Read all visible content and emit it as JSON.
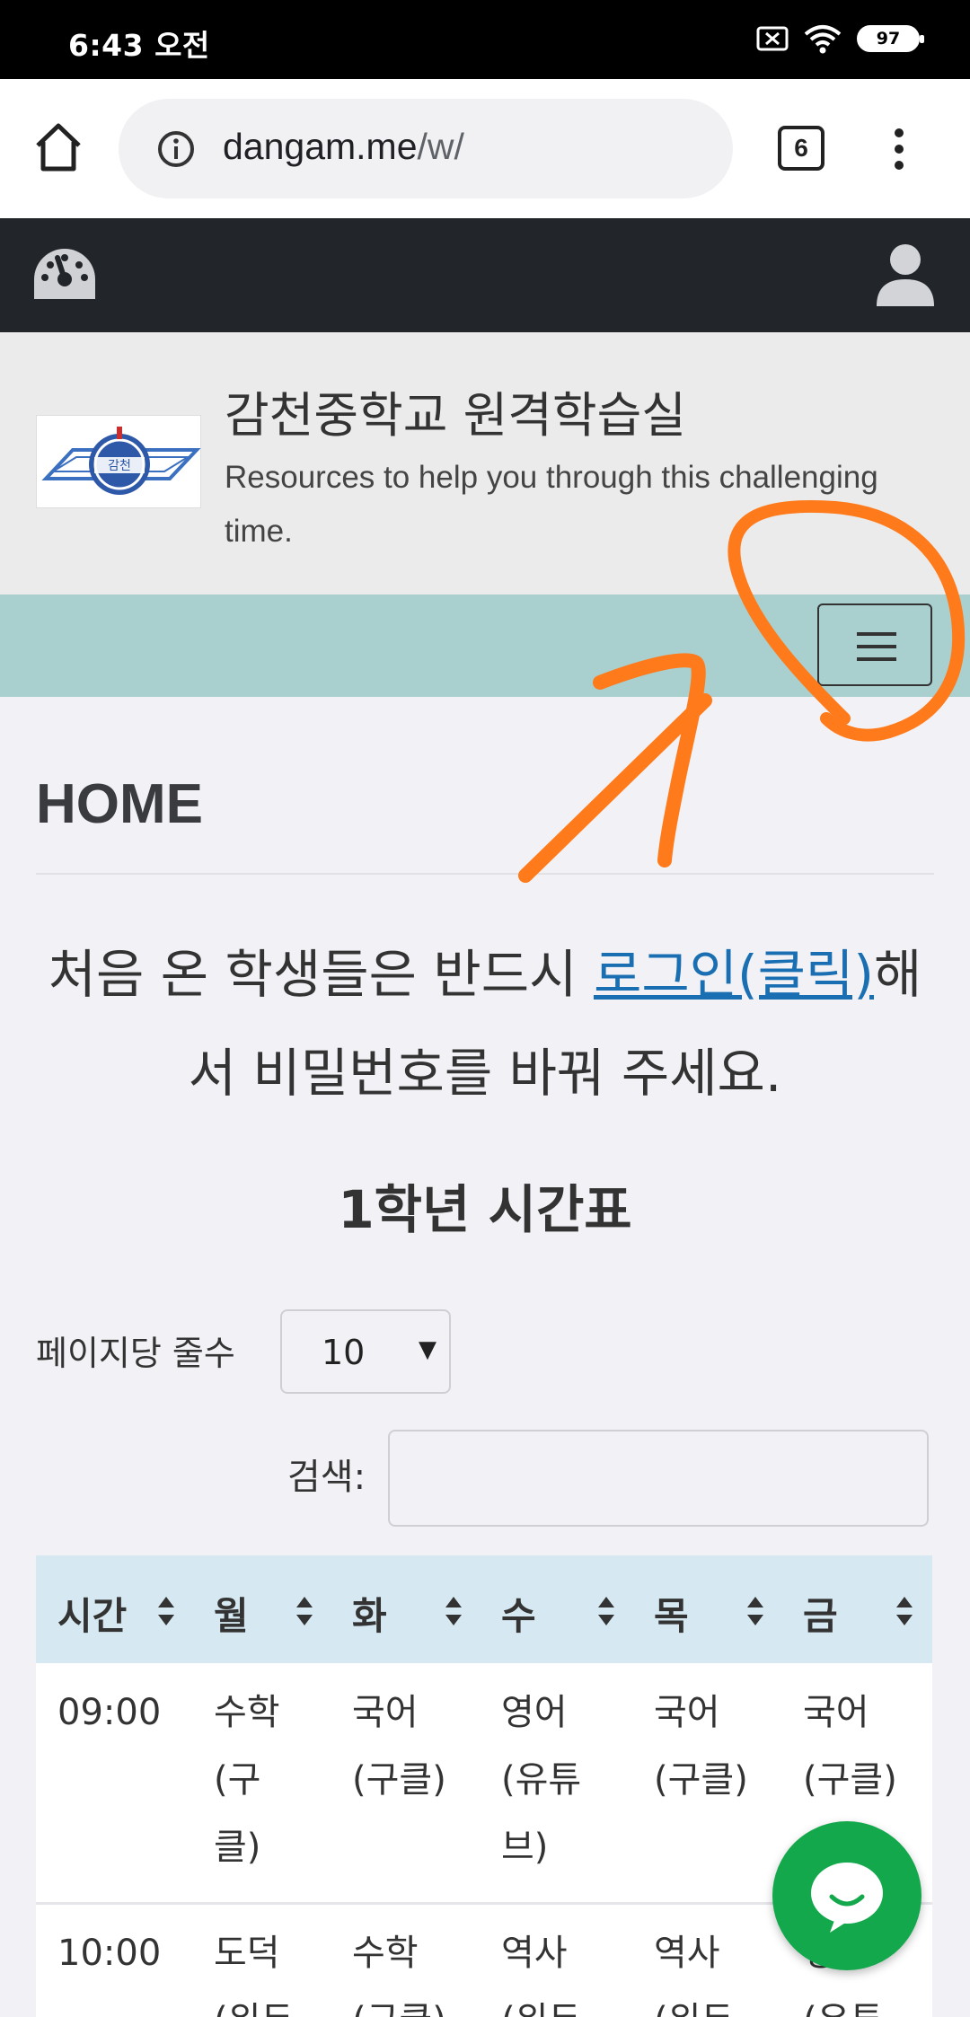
{
  "status_bar": {
    "time": "6:43 오전",
    "battery": "97"
  },
  "browser": {
    "url_host": "dangam.me",
    "url_path": "/w/",
    "tab_count": "6"
  },
  "site": {
    "title": "감천중학교 원격학습실",
    "tagline": "Resources to help you through this challenging time.",
    "logo_text": "감천"
  },
  "page": {
    "heading": "HOME",
    "notice_prefix": "처음 온 학생들은 반드시 ",
    "notice_link": "로그인(클릭)",
    "notice_suffix": "해서 비밀번호를 바꿔 주세요.",
    "timetable_title": "1학년 시간표"
  },
  "table_controls": {
    "length_label": "페이지당 줄수",
    "length_value": "10",
    "search_label": "검색:",
    "search_value": ""
  },
  "timetable": {
    "headers": [
      "시간",
      "월",
      "화",
      "수",
      "목",
      "금"
    ],
    "rows": [
      {
        "time": "09:00",
        "mon": [
          "수학",
          "(구",
          "클)"
        ],
        "tue": [
          "국어",
          "(구클)"
        ],
        "wed": [
          "영어",
          "(유튜",
          "브)"
        ],
        "thu": [
          "국어",
          "(구클)"
        ],
        "fri": [
          "국어",
          "(구클)"
        ]
      },
      {
        "time": "10:00",
        "mon": [
          "도덕",
          "(위두"
        ],
        "tue": [
          "수학",
          "(구클)"
        ],
        "wed": [
          "역사",
          "(위두"
        ],
        "thu": [
          "역사",
          "(위두"
        ],
        "fri": [
          "영어",
          "(유튜"
        ]
      }
    ]
  },
  "colors": {
    "navbar": "#22262b",
    "teal_bar": "#a9cfcf",
    "table_head": "#d6e9f2",
    "link": "#1a6fb3",
    "chat_fab": "#14a84c",
    "annotation": "#ff7a1a"
  }
}
